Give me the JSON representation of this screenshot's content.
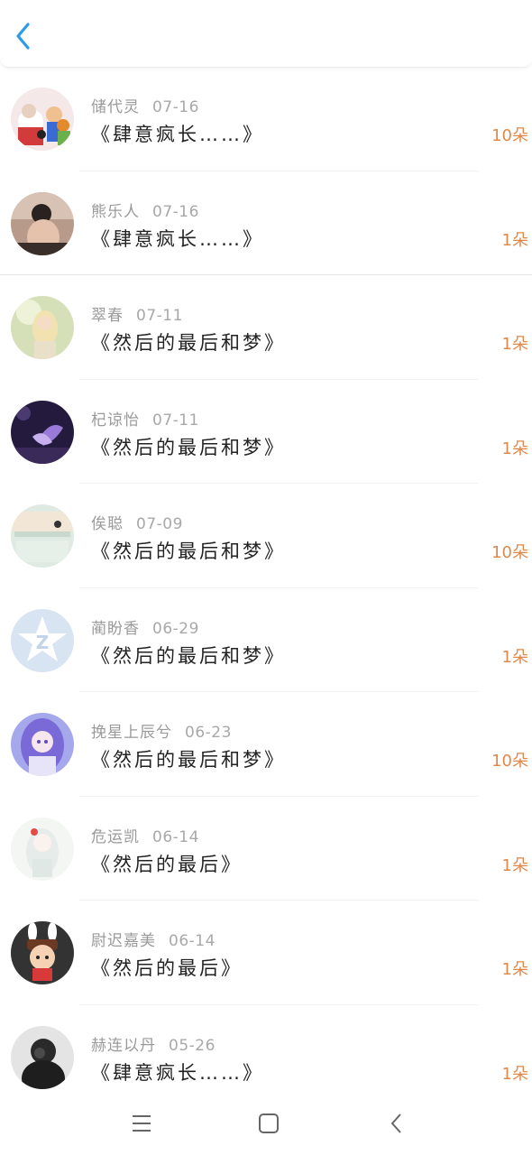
{
  "header": {
    "back_icon": "chevron-left-icon",
    "accent_color": "#2a9de8"
  },
  "items": [
    {
      "name": "储代灵",
      "date": "07-16",
      "title": "《肆意疯长……》",
      "count": "10朵"
    },
    {
      "name": "熊乐人",
      "date": "07-16",
      "title": "《肆意疯长……》",
      "count": "1朵"
    },
    {
      "name": "翠春",
      "date": "07-11",
      "title": "《然后的最后和梦》",
      "count": "1朵"
    },
    {
      "name": "杞谅怡",
      "date": "07-11",
      "title": "《然后的最后和梦》",
      "count": "1朵"
    },
    {
      "name": "俟聪",
      "date": "07-09",
      "title": "《然后的最后和梦》",
      "count": "10朵"
    },
    {
      "name": "蔺盼香",
      "date": "06-29",
      "title": "《然后的最后和梦》",
      "count": "1朵"
    },
    {
      "name": "挽星上辰兮",
      "date": "06-23",
      "title": "《然后的最后和梦》",
      "count": "10朵"
    },
    {
      "name": "危运凯",
      "date": "06-14",
      "title": "《然后的最后》",
      "count": "1朵"
    },
    {
      "name": "尉迟嘉美",
      "date": "06-14",
      "title": "《然后的最后》",
      "count": "1朵"
    },
    {
      "name": "赫连以丹",
      "date": "05-26",
      "title": "《肆意疯长……》",
      "count": "1朵"
    }
  ],
  "navbar": {
    "menu_icon": "menu-icon",
    "home_icon": "home-square-icon",
    "back_icon": "back-chevron-icon"
  },
  "colors": {
    "count": "#e0884a",
    "name": "#9a9a9a",
    "title": "#222222"
  }
}
